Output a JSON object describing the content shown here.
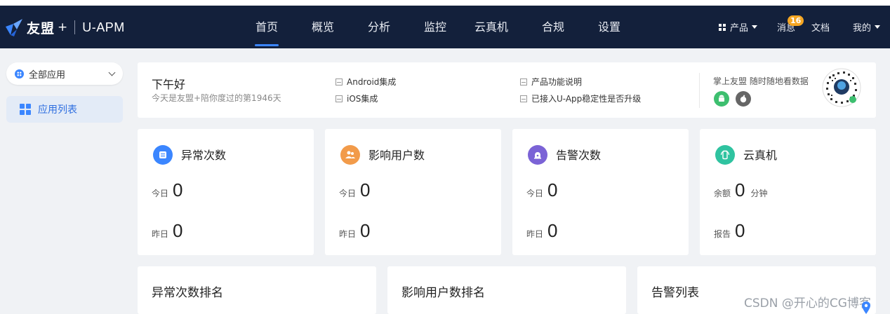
{
  "header": {
    "brand": "友盟",
    "plus": "+",
    "product": "U-APM",
    "nav": [
      "首页",
      "概览",
      "分析",
      "监控",
      "云真机",
      "合规",
      "设置"
    ],
    "active_nav": "首页",
    "products_label": "产品",
    "messages_label": "消息",
    "messages_badge": "16",
    "docs_label": "文档",
    "mine_label": "我的"
  },
  "sidebar": {
    "app_select": "全部应用",
    "items": [
      {
        "label": "应用列表"
      }
    ]
  },
  "welcome": {
    "greeting": "下午好",
    "subtitle": "今天是友盟+陪你度过的第1946天",
    "links": [
      "Android集成",
      "iOS集成",
      "产品功能说明",
      "已接入U-App稳定性是否升级"
    ],
    "mobile_title": "掌上友盟 随时随地看数据"
  },
  "stats": [
    {
      "title": "异常次数",
      "icon": "exception-icon",
      "color": "#3b86ff",
      "rows": [
        {
          "label": "今日",
          "value": "0"
        },
        {
          "label": "昨日",
          "value": "0"
        }
      ]
    },
    {
      "title": "影响用户数",
      "icon": "users-icon",
      "color": "#f29b4a",
      "rows": [
        {
          "label": "今日",
          "value": "0"
        },
        {
          "label": "昨日",
          "value": "0"
        }
      ]
    },
    {
      "title": "告警次数",
      "icon": "alarm-icon",
      "color": "#7b63d6",
      "rows": [
        {
          "label": "今日",
          "value": "0"
        },
        {
          "label": "昨日",
          "value": "0"
        }
      ]
    },
    {
      "title": "云真机",
      "icon": "phone-icon",
      "color": "#2fc3a0",
      "rows": [
        {
          "label": "余额",
          "value": "0",
          "unit": "分钟"
        },
        {
          "label": "报告",
          "value": "0"
        }
      ]
    }
  ],
  "panels": [
    "异常次数排名",
    "影响用户数排名",
    "告警列表"
  ],
  "watermark": "CSDN @开心的CG博客"
}
